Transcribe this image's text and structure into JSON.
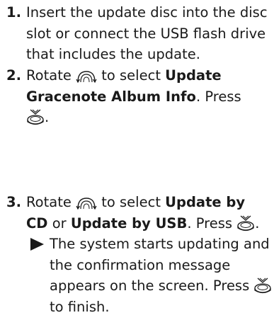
{
  "steps": [
    {
      "number": "1.",
      "lines": [
        "Insert the update disc into the disc",
        "slot or connect the USB flash drive",
        "that includes the update."
      ]
    },
    {
      "number": "2.",
      "rotate": "Rotate",
      "to_select": "to select",
      "option": "Update",
      "option2": "Gracenote Album Info",
      "press": ". Press",
      "period": "."
    },
    {
      "number": "3.",
      "rotate": "Rotate",
      "to_select": "to select",
      "option_a1": "Update by",
      "option_a2": "CD",
      "or": "or",
      "option_b": "Update by USB",
      "press": ". Press",
      "period": ".",
      "result_lines": [
        "The system starts updating and",
        "the confirmation message",
        "appears on the screen. Press",
        "to finish."
      ]
    }
  ],
  "icons": {
    "rotate": "rotate-knob-icon",
    "press": "press-knob-icon"
  }
}
